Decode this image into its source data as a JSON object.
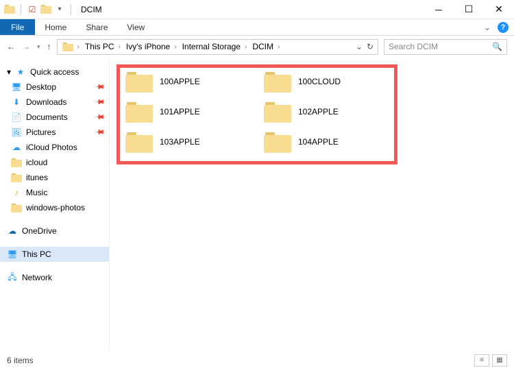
{
  "window": {
    "title": "DCIM"
  },
  "ribbon": {
    "file": "File",
    "tabs": [
      "Home",
      "Share",
      "View"
    ]
  },
  "nav": {
    "crumbs": [
      "This PC",
      "Ivy's iPhone",
      "Internal Storage",
      "DCIM"
    ],
    "refresh_glyph": "↻",
    "dropdown_glyph": "⌄"
  },
  "search": {
    "placeholder": "Search DCIM"
  },
  "sidebar": {
    "quick_access": {
      "label": "Quick access",
      "items": [
        {
          "label": "Desktop",
          "pinned": true,
          "icon": "desktop"
        },
        {
          "label": "Downloads",
          "pinned": true,
          "icon": "download"
        },
        {
          "label": "Documents",
          "pinned": true,
          "icon": "document"
        },
        {
          "label": "Pictures",
          "pinned": true,
          "icon": "picture"
        },
        {
          "label": "iCloud Photos",
          "pinned": false,
          "icon": "icloud"
        },
        {
          "label": "icloud",
          "pinned": false,
          "icon": "folder"
        },
        {
          "label": "itunes",
          "pinned": false,
          "icon": "folder"
        },
        {
          "label": "Music",
          "pinned": false,
          "icon": "music"
        },
        {
          "label": "windows-photos",
          "pinned": false,
          "icon": "folder"
        }
      ]
    },
    "onedrive": {
      "label": "OneDrive"
    },
    "this_pc": {
      "label": "This PC"
    },
    "network": {
      "label": "Network"
    }
  },
  "content": {
    "folders": [
      {
        "name": "100APPLE"
      },
      {
        "name": "100CLOUD"
      },
      {
        "name": "101APPLE"
      },
      {
        "name": "102APPLE"
      },
      {
        "name": "103APPLE"
      },
      {
        "name": "104APPLE"
      }
    ]
  },
  "statusbar": {
    "count_text": "6 items"
  }
}
